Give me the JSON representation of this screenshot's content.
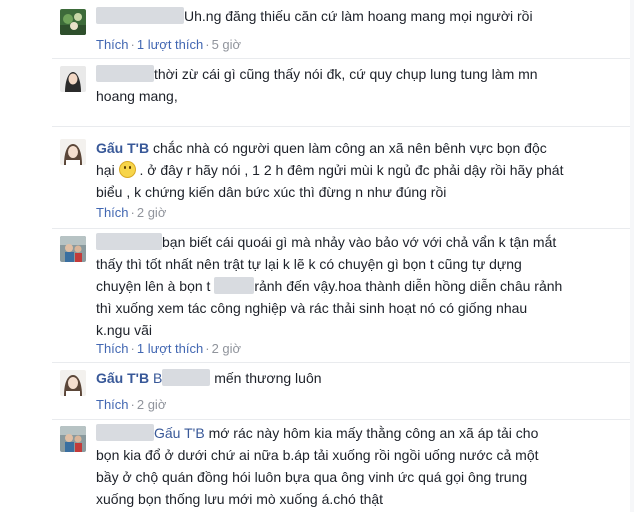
{
  "comments": [
    {
      "author": "",
      "text": "Uh.ng đăng thiếu căn cứ làm hoang mang mọi người rồi",
      "like_label": "Thích",
      "like_count": "1 lượt thích",
      "time": "5 giờ"
    },
    {
      "author": "",
      "text_lines": [
        "thời zừ cái gì cũng thấy nói đk, cứ quy chụp lung tung làm mn",
        "hoang mang,"
      ]
    },
    {
      "author": "Gấu T'B",
      "line1": "chắc nhà có người quen làm công an xã nên bênh vực bọn độc",
      "line2_a": "hại",
      "line2_b": ". ở đây r hãy nói , 1 2 h đêm ngửi mùi k ngủ đc phải dậy rồi hãy phát",
      "line3": "biểu , k chứng kiến dân bức xúc thì đừng n như đúng rồi",
      "like_label": "Thích",
      "time": "2 giờ"
    },
    {
      "author": "",
      "text_lines": [
        "bạn biết cái quoái gì mà nhảy vào bảo vớ với chả vẩn k tận mắt",
        "thấy thì tốt nhất nên trật tự lại k lẽ k có chuyện gì bọn t cũng tự dựng",
        "chuyện lên à bọn t",
        "rảnh đến vậy.hoa thành diễn hồng diễn châu rảnh",
        "thì xuống xem tác công nghiệp và rác thải sinh hoạt nó có giống nhau",
        "k.ngu vãi"
      ],
      "like_label": "Thích",
      "like_count": "1 lượt thích",
      "time": "2 giờ"
    },
    {
      "author": "Gấu T'B",
      "mention_prefix": "B",
      "text": "mến thương luôn",
      "like_label": "Thích",
      "time": "2 giờ"
    },
    {
      "author": "",
      "mention": "Gấu T'B",
      "text_lines": [
        "mớ rác này hôm kia mấy thằng công an xã áp tải cho",
        "bọn kia đổ ở dưới chứ ai nữa b.áp tải xuống rồi ngồi uống nước cả một",
        "bầy ở chộ quán đồng hói luôn bựa qua ông vinh ức quá gọi ông trung",
        "xuống bọn thống lưu mới mò xuống á.chó thật"
      ]
    }
  ]
}
